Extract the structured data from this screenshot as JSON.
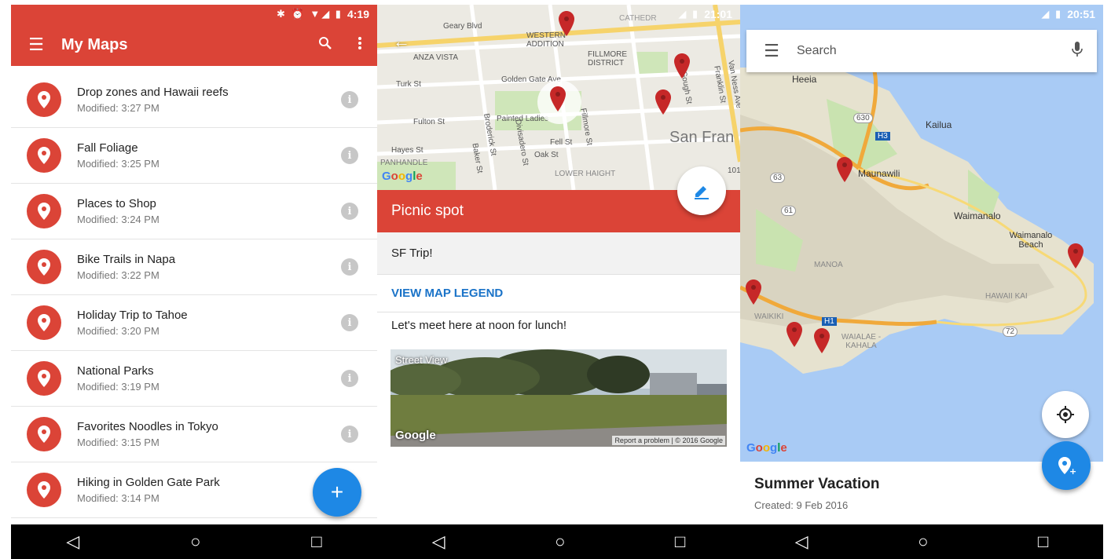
{
  "colors": {
    "accent_red": "#db4437",
    "accent_blue": "#1e88e5",
    "link_blue": "#1a73c8"
  },
  "screen1": {
    "status_time": "4:19",
    "title": "My Maps",
    "menu_icon": "hamburger-icon",
    "search_icon": "search-icon",
    "overflow_icon": "more-vert-icon",
    "maps": [
      {
        "name": "Drop zones and Hawaii reefs",
        "modified": "Modified: 3:27 PM"
      },
      {
        "name": "Fall Foliage",
        "modified": "Modified: 3:25 PM"
      },
      {
        "name": "Places to Shop",
        "modified": "Modified: 3:24 PM"
      },
      {
        "name": "Bike Trails in Napa",
        "modified": "Modified: 3:22 PM"
      },
      {
        "name": "Holiday Trip to Tahoe",
        "modified": "Modified: 3:20 PM"
      },
      {
        "name": "National Parks",
        "modified": "Modified: 3:19 PM"
      },
      {
        "name": "Favorites Noodles in Tokyo",
        "modified": "Modified: 3:15 PM"
      },
      {
        "name": "Hiking in Golden Gate Park",
        "modified": "Modified: 3:14 PM"
      }
    ],
    "fab_label": "+"
  },
  "screen2": {
    "status_time": "21:01",
    "map_labels": {
      "geary": "Geary Blvd",
      "western": "WESTERN ADDITION",
      "anza": "ANZA VISTA",
      "fillmore_d": "FILLMORE DISTRICT",
      "turk": "Turk St",
      "golden_gate": "Golden Gate Ave",
      "fulton": "Fulton St",
      "painted": "Painted Ladies",
      "hayes": "Hayes St",
      "fell": "Fell St",
      "oak": "Oak St",
      "panhandle": "PANHANDLE",
      "lower_haight": "LOWER HAIGHT",
      "san_fran": "San Fran",
      "baker": "Baker St",
      "broderick": "Broderick St",
      "divisadero": "Divisadero St",
      "fillmore_st": "Fillmore St",
      "gough": "Gough St",
      "franklin": "Franklin St",
      "van_ness": "Van Ness Ave",
      "cathedral": "CATHEDR",
      "hwy": "101"
    },
    "place_title": "Picnic spot",
    "map_name": "SF Trip!",
    "legend_link": "VIEW MAP LEGEND",
    "description": "Let's meet here at noon for lunch!",
    "streetview_label": "Street View",
    "streetview_google": "Google",
    "streetview_credit": "Report a problem | © 2016 Google"
  },
  "screen3": {
    "status_time": "20:51",
    "search_placeholder": "Search",
    "map_labels": {
      "heeia": "Heeia",
      "kailua": "Kailua",
      "maunawili": "Maunawili",
      "waimanalo": "Waimanalo",
      "waimanalo_beach": "Waimanalo Beach",
      "manoa": "MANOA",
      "hawaii_kai": "HAWAII KAI",
      "waikiki": "WAIKIKI",
      "waialae": "WAIALAE - KAHALA",
      "r630": "630",
      "r63": "63",
      "r61": "61",
      "h3": "H3",
      "h1": "H1",
      "r72": "72"
    },
    "map_title": "Summer Vacation",
    "created": "Created: 9 Feb 2016"
  },
  "google_logo": [
    "G",
    "o",
    "o",
    "g",
    "l",
    "e"
  ],
  "nav": {
    "back_icon": "◁",
    "home_icon": "○",
    "recents_icon": "□"
  }
}
